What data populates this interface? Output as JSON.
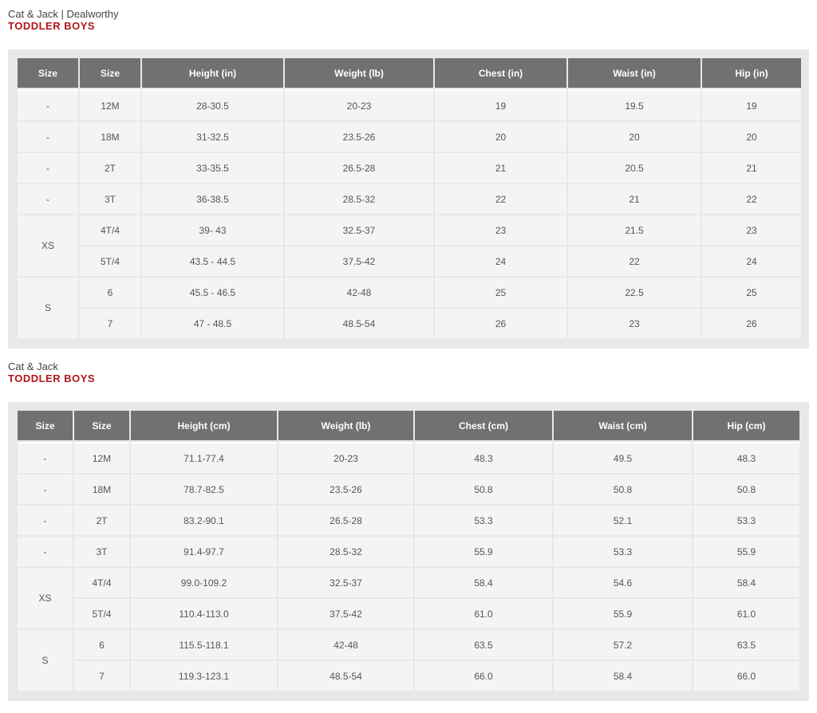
{
  "sections": [
    {
      "brand": "Cat & Jack | Dealworthy",
      "title": "TODDLER BOYS",
      "headers": [
        "Size",
        "Size",
        "Height (in)",
        "Weight (lb)",
        "Chest (in)",
        "Waist (in)",
        "Hip (in)"
      ],
      "rows": [
        [
          "-",
          "12M",
          "28-30.5",
          "20-23",
          "19",
          "19.5",
          "19"
        ],
        [
          "-",
          "18M",
          "31-32.5",
          "23.5-26",
          "20",
          "20",
          "20"
        ],
        [
          "-",
          "2T",
          "33-35.5",
          "26.5-28",
          "21",
          "20.5",
          "21"
        ],
        [
          "-",
          "3T",
          "36-38.5",
          "28.5-32",
          "22",
          "21",
          "22"
        ],
        [
          "XS",
          "4T/4",
          "39- 43",
          "32.5-37",
          "23",
          "21.5",
          "23"
        ],
        [
          "",
          "5T/4",
          "43.5 - 44.5",
          "37.5-42",
          "24",
          "22",
          "24"
        ],
        [
          "S",
          "6",
          "45.5 - 46.5",
          "42-48",
          "25",
          "22.5",
          "25"
        ],
        [
          "",
          "7",
          "47 - 48.5",
          "48.5-54",
          "26",
          "23",
          "26"
        ]
      ]
    },
    {
      "brand": "Cat & Jack",
      "title": "TODDLER BOYS",
      "headers": [
        "Size",
        "Size",
        "Height (cm)",
        "Weight (lb)",
        "Chest (cm)",
        "Waist (cm)",
        "Hip (cm)"
      ],
      "rows": [
        [
          "-",
          "12M",
          "71.1-77.4",
          "20-23",
          "48.3",
          "49.5",
          "48.3"
        ],
        [
          "-",
          "18M",
          "78.7-82.5",
          "23.5-26",
          "50.8",
          "50.8",
          "50.8"
        ],
        [
          "-",
          "2T",
          "83.2-90.1",
          "26.5-28",
          "53.3",
          "52.1",
          "53.3"
        ],
        [
          "-",
          "3T",
          "91.4-97.7",
          "28.5-32",
          "55.9",
          "53.3",
          "55.9"
        ],
        [
          "XS",
          "4T/4",
          "99.0-109.2",
          "32.5-37",
          "58.4",
          "54.6",
          "58.4"
        ],
        [
          "",
          "5T/4",
          "110.4-113.0",
          "37.5-42",
          "61.0",
          "55.9",
          "61.0"
        ],
        [
          "S",
          "6",
          "115.5-118.1",
          "42-48",
          "63.5",
          "57.2",
          "63.5"
        ],
        [
          "",
          "7",
          "119.3-123.1",
          "48.5-54",
          "66.0",
          "58.4",
          "66.0"
        ]
      ]
    }
  ]
}
